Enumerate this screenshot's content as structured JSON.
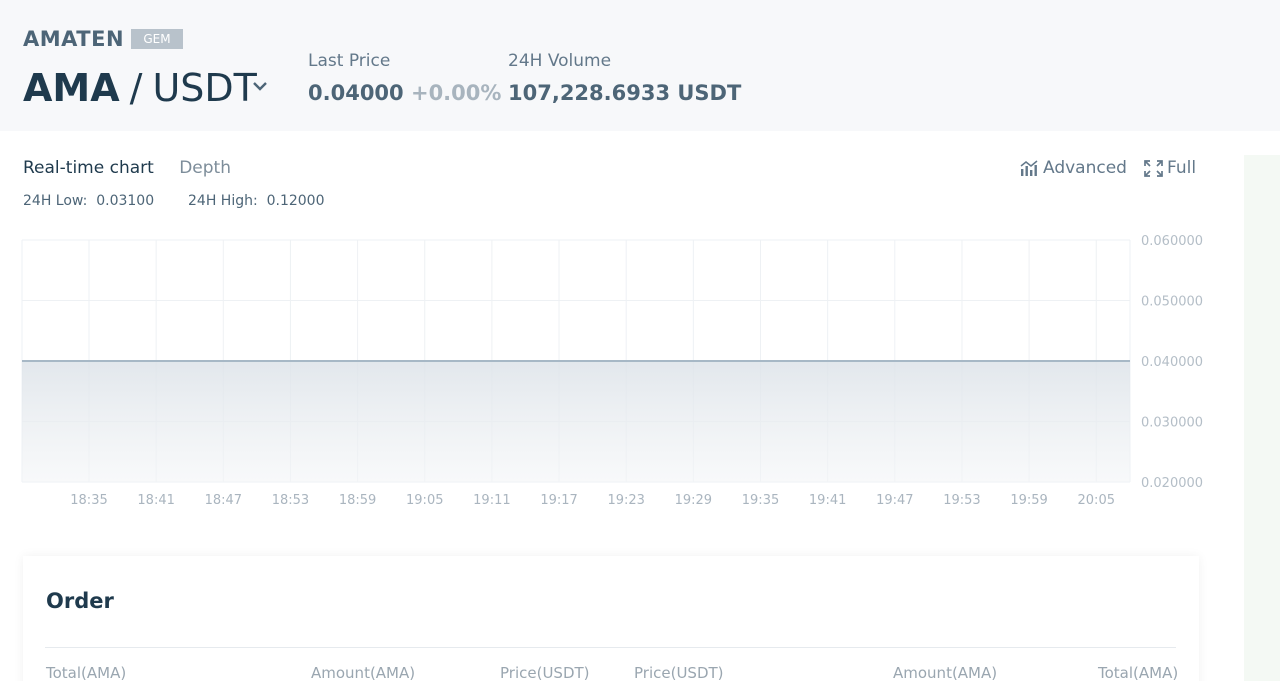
{
  "header": {
    "coin_name": "AMATEN",
    "badge": "GEM",
    "base": "AMA",
    "separator": "/",
    "quote": "USDT",
    "last_price_label": "Last Price",
    "last_price": "0.04000",
    "change": "+0.00%",
    "volume_label": "24H Volume",
    "volume": "107,228.6933 USDT"
  },
  "tabs": {
    "realtime": "Real-time chart",
    "depth": "Depth"
  },
  "tools": {
    "advanced": "Advanced",
    "full": "Full"
  },
  "range": {
    "low_label": "24H Low:",
    "low_value": "0.03100",
    "high_label": "24H High:",
    "high_value": "0.12000"
  },
  "chart_data": {
    "type": "area",
    "x": [
      "18:35",
      "18:41",
      "18:47",
      "18:53",
      "18:59",
      "19:05",
      "19:11",
      "19:17",
      "19:23",
      "19:29",
      "19:35",
      "19:41",
      "19:47",
      "19:53",
      "19:59",
      "20:05"
    ],
    "values": [
      0.04,
      0.04,
      0.04,
      0.04,
      0.04,
      0.04,
      0.04,
      0.04,
      0.04,
      0.04,
      0.04,
      0.04,
      0.04,
      0.04,
      0.04,
      0.04
    ],
    "ylim": [
      0.02,
      0.06
    ],
    "yticks": [
      "0.060000",
      "0.050000",
      "0.040000",
      "0.030000",
      "0.020000"
    ],
    "grid": true,
    "line_color": "#a7b8c6"
  },
  "order": {
    "title": "Order",
    "columns": [
      "Total(AMA)",
      "Amount(AMA)",
      "Price(USDT)",
      "Price(USDT)",
      "Amount(AMA)",
      "Total(AMA)"
    ]
  },
  "colors": {
    "primary_text": "#1f3a4d",
    "muted_text": "#63788a",
    "badge_bg": "#b8c2cb"
  },
  "icons": {
    "pair_dropdown": "chevron-down-icon",
    "advanced": "chart-icon",
    "full": "fullscreen-icon"
  }
}
